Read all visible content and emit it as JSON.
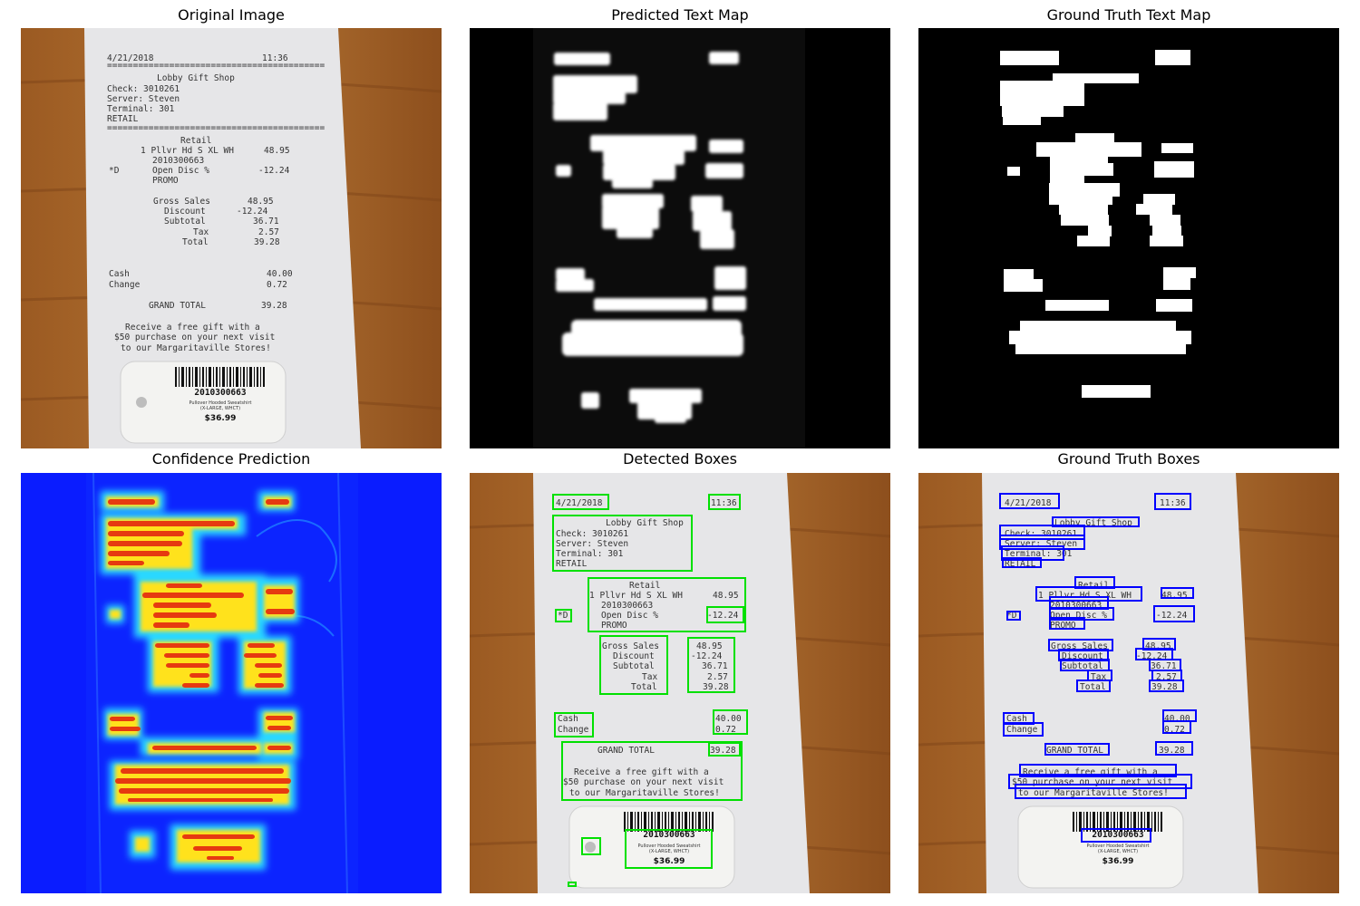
{
  "panels": {
    "original": {
      "title": "Original Image"
    },
    "predicted_map": {
      "title": "Predicted Text Map"
    },
    "gt_map": {
      "title": "Ground Truth Text Map"
    },
    "confidence": {
      "title": "Confidence Prediction"
    },
    "detected": {
      "title": "Detected Boxes"
    },
    "gt_boxes": {
      "title": "Ground Truth Boxes"
    }
  },
  "colors": {
    "detected_box": "#00e000",
    "gt_box": "#0000ff",
    "wood": "#a8672e",
    "paper": "#e9e9ec",
    "map_text": "#ffffff",
    "map_bg": "#000000",
    "heat_bg": "#0a1cff"
  },
  "receipt": {
    "date": "4/21/2018",
    "time": "11:36",
    "shop": "Lobby Gift Shop",
    "check": "Check: 3010261",
    "server": "Server: Steven",
    "terminal": "Terminal: 301",
    "retail_header": "RETAIL",
    "retail": "Retail",
    "item": "1 Pllvr Hd S XL WH",
    "item_price": "48.95",
    "sku": "2010300663",
    "d_mark": "*D",
    "open_disc": "Open Disc %",
    "disc_value": "-12.24",
    "promo": "PROMO",
    "gross_sales": "Gross Sales",
    "gross_value": "48.95",
    "discount": "Discount",
    "discount_value": "-12.24",
    "subtotal": "Subtotal",
    "subtotal_value": "36.71",
    "tax": "Tax",
    "tax_value": "2.57",
    "total": "Total",
    "total_value": "39.28",
    "cash": "Cash",
    "cash_value": "40.00",
    "change": "Change",
    "change_value": "0.72",
    "grand_total": "GRAND TOTAL",
    "grand_value": "39.28",
    "promo_line1": "Receive a free gift with a",
    "promo_line2": "$50 purchase on your next visit",
    "promo_line3": "to our Margaritaville Stores!"
  },
  "tag": {
    "barcode_number": "2010300663",
    "desc1": "Pullover Hooded Sweatshirt",
    "desc2": "(X-LARGE, WHCT)",
    "price": "$36.99"
  }
}
